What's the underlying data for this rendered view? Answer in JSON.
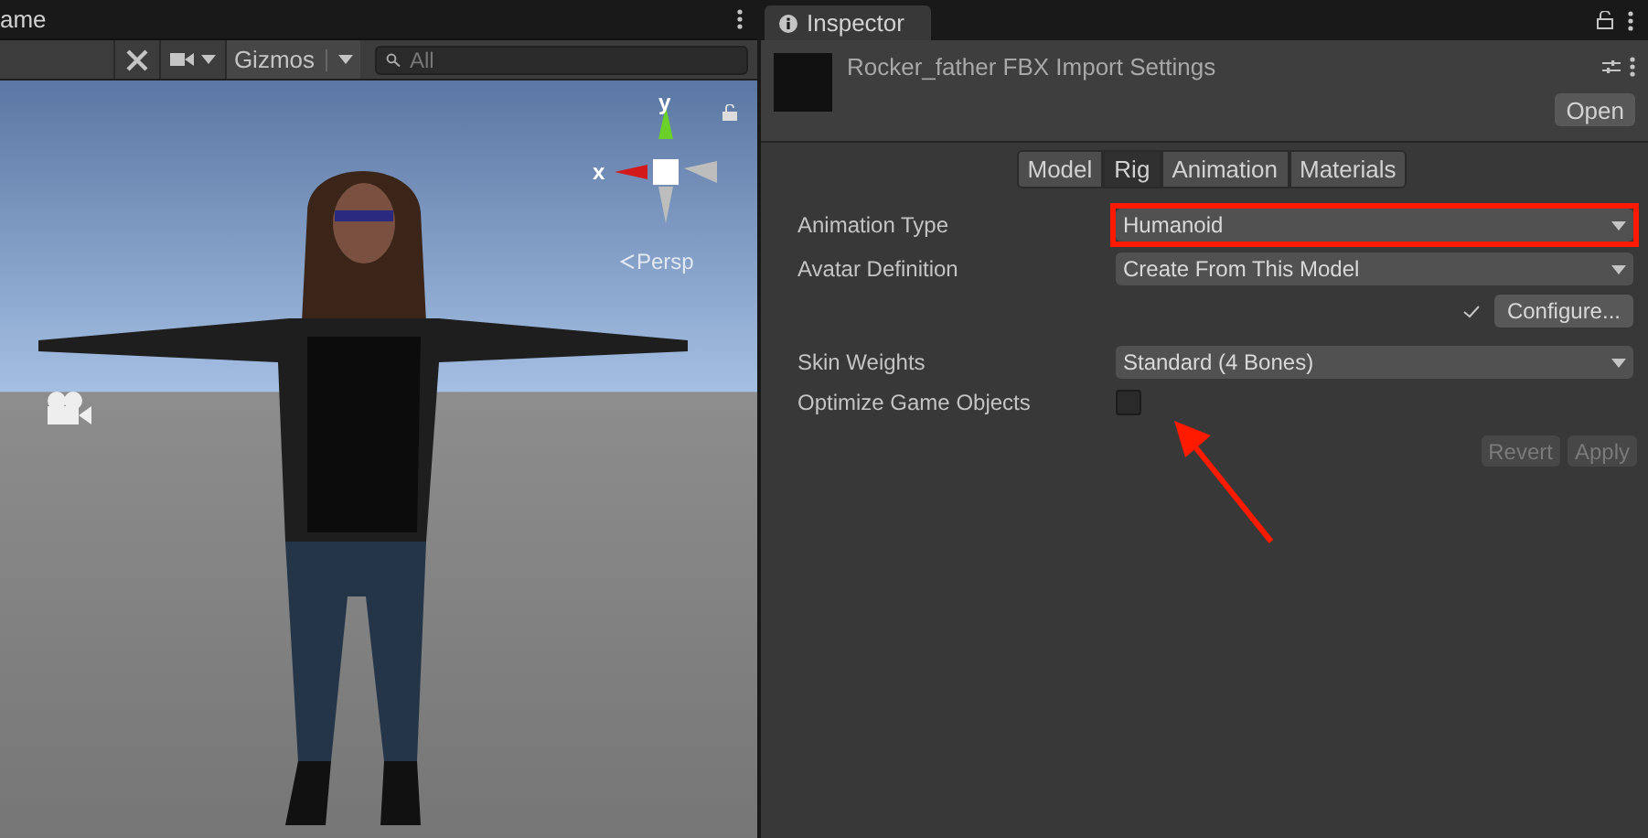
{
  "scene_tab": {
    "title": "ame"
  },
  "scene_toolbar": {
    "gizmos": "Gizmos",
    "search": {
      "placeholder": "All"
    }
  },
  "gizmo": {
    "y_label": "y",
    "x_label": "x",
    "projection": "Persp"
  },
  "inspector": {
    "tab": "Inspector",
    "asset_title": "Rocker_father FBX Import Settings",
    "open_button": "Open",
    "tabs": [
      {
        "label": "Model",
        "selected": false
      },
      {
        "label": "Rig",
        "selected": true
      },
      {
        "label": "Animation",
        "selected": false
      },
      {
        "label": "Materials",
        "selected": false
      }
    ],
    "rows": [
      {
        "kind": "dropdown",
        "label": "Animation Type",
        "value": "Humanoid",
        "highlighted": true
      },
      {
        "kind": "dropdown",
        "label": "Avatar Definition",
        "value": "Create From This Model",
        "highlighted": false
      },
      {
        "kind": "configure",
        "label": "Configure...",
        "checked": true
      },
      {
        "kind": "dropdown",
        "label": "Skin Weights",
        "value": "Standard (4 Bones)",
        "highlighted": false
      },
      {
        "kind": "checkbox",
        "label": "Optimize Game Objects",
        "checked": false
      }
    ],
    "buttons": [
      {
        "label": "Revert",
        "disabled": true
      },
      {
        "label": "Apply",
        "disabled": true
      }
    ]
  }
}
